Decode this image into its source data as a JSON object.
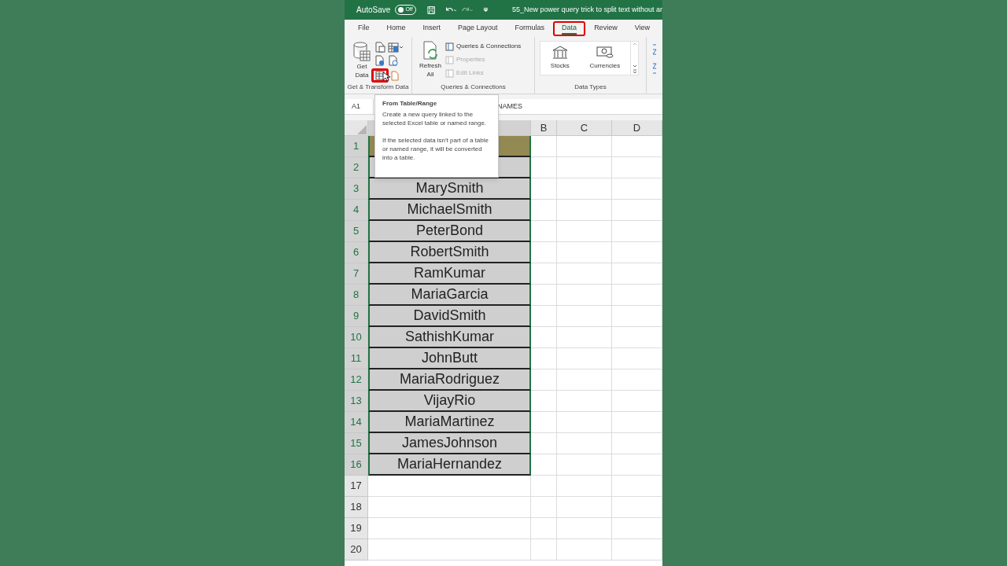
{
  "title_bar": {
    "autosave_label": "AutoSave",
    "autosave_toggle": {
      "label": "Off",
      "on": false
    },
    "document_title": "55_New power query trick to split text without ar"
  },
  "tabs": [
    {
      "label": "File",
      "selected": false,
      "highlighted": false
    },
    {
      "label": "Home",
      "selected": false,
      "highlighted": false
    },
    {
      "label": "Insert",
      "selected": false,
      "highlighted": false
    },
    {
      "label": "Page Layout",
      "selected": false,
      "highlighted": false
    },
    {
      "label": "Formulas",
      "selected": false,
      "highlighted": false
    },
    {
      "label": "Data",
      "selected": true,
      "highlighted": true
    },
    {
      "label": "Review",
      "selected": false,
      "highlighted": false
    },
    {
      "label": "View",
      "selected": false,
      "highlighted": false
    }
  ],
  "ribbon": {
    "get_transform": {
      "get_data_label": "Get Data",
      "from_table_highlighted": true,
      "group_label": "Get & Transform Data"
    },
    "queries": {
      "refresh_label": "Refresh All",
      "items": [
        {
          "label": "Queries & Connections",
          "disabled": false
        },
        {
          "label": "Properties",
          "disabled": true
        },
        {
          "label": "Edit Links",
          "disabled": true
        }
      ],
      "group_label": "Queries & Connections"
    },
    "data_types": {
      "items": [
        "Stocks",
        "Currencies"
      ],
      "group_label": "Data Types"
    }
  },
  "formula_bar": {
    "name_box": "A1",
    "formula": "NAMES"
  },
  "columns": [
    "B",
    "C",
    "D"
  ],
  "rows": [
    {
      "number": "1",
      "selected": true,
      "kind": "header"
    },
    {
      "number": "2",
      "selected": true,
      "kind": "data"
    },
    {
      "number": "3",
      "selected": true,
      "kind": "data",
      "name": "MarySmith"
    },
    {
      "number": "4",
      "selected": true,
      "kind": "data",
      "name": "MichaelSmith"
    },
    {
      "number": "5",
      "selected": true,
      "kind": "data",
      "name": "PeterBond"
    },
    {
      "number": "6",
      "selected": true,
      "kind": "data",
      "name": "RobertSmith"
    },
    {
      "number": "7",
      "selected": true,
      "kind": "data",
      "name": "RamKumar"
    },
    {
      "number": "8",
      "selected": true,
      "kind": "data",
      "name": "MariaGarcia"
    },
    {
      "number": "9",
      "selected": true,
      "kind": "data",
      "name": "DavidSmith"
    },
    {
      "number": "10",
      "selected": true,
      "kind": "data",
      "name": "SathishKumar"
    },
    {
      "number": "11",
      "selected": true,
      "kind": "data",
      "name": "JohnButt"
    },
    {
      "number": "12",
      "selected": true,
      "kind": "data",
      "name": "MariaRodriguez"
    },
    {
      "number": "13",
      "selected": true,
      "kind": "data",
      "name": "VijayRio"
    },
    {
      "number": "14",
      "selected": true,
      "kind": "data",
      "name": "MariaMartinez"
    },
    {
      "number": "15",
      "selected": true,
      "kind": "data",
      "name": "JamesJohnson"
    },
    {
      "number": "16",
      "selected": true,
      "kind": "data",
      "name": "MariaHernandez"
    },
    {
      "number": "17",
      "selected": false,
      "kind": "empty"
    },
    {
      "number": "18",
      "selected": false,
      "kind": "empty"
    },
    {
      "number": "19",
      "selected": false,
      "kind": "empty"
    },
    {
      "number": "20",
      "selected": false,
      "kind": "empty"
    }
  ],
  "tooltip": {
    "title": "From Table/Range",
    "paragraphs": [
      "Create a new query linked to the selected Excel table or named range.",
      "If the selected data isn't part of a table or named range, it will be converted into a table."
    ]
  }
}
